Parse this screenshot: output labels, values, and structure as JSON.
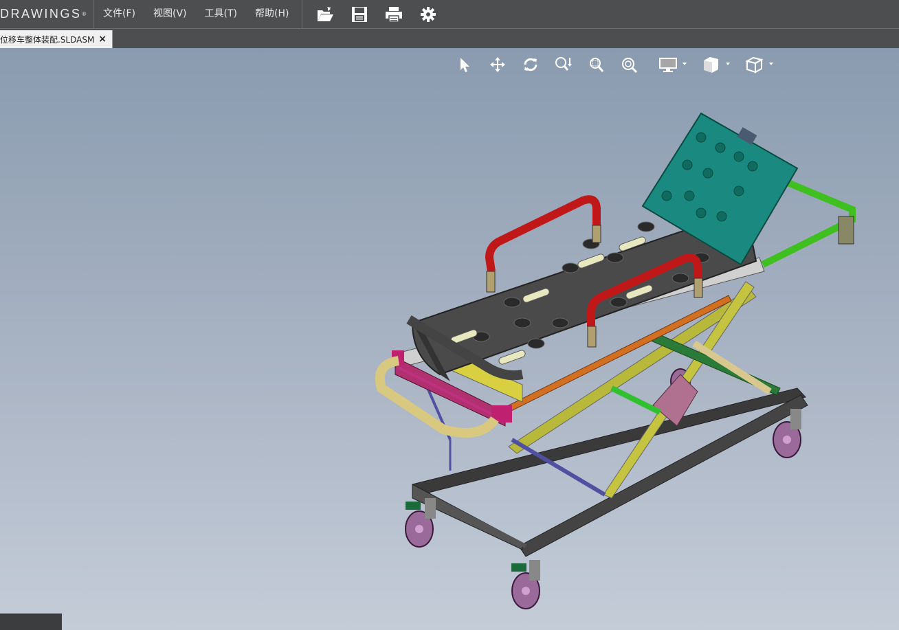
{
  "app": {
    "logo_text": "DRAWINGS",
    "logo_mark": "®"
  },
  "menu": [
    "文件(F)",
    "视图(V)",
    "工具(T)",
    "帮助(H)"
  ],
  "toolbar": [
    "open-icon",
    "save-icon",
    "print-icon",
    "settings-icon"
  ],
  "tab": {
    "label": "位移车整体装配.SLDASM",
    "close": "×"
  },
  "view_toolbar": [
    "select-icon",
    "pan-icon",
    "rotate-icon",
    "zoom-icon",
    "zoom-area-icon",
    "zoom-fit-icon",
    "display-style-icon",
    "view-orientation-icon",
    "standard-views-icon"
  ],
  "colors": {
    "bar": "#4d4e50",
    "viewport_top": "#8a9bb0",
    "viewport_bottom": "#c4ccd8",
    "accent": "#ffffff"
  }
}
